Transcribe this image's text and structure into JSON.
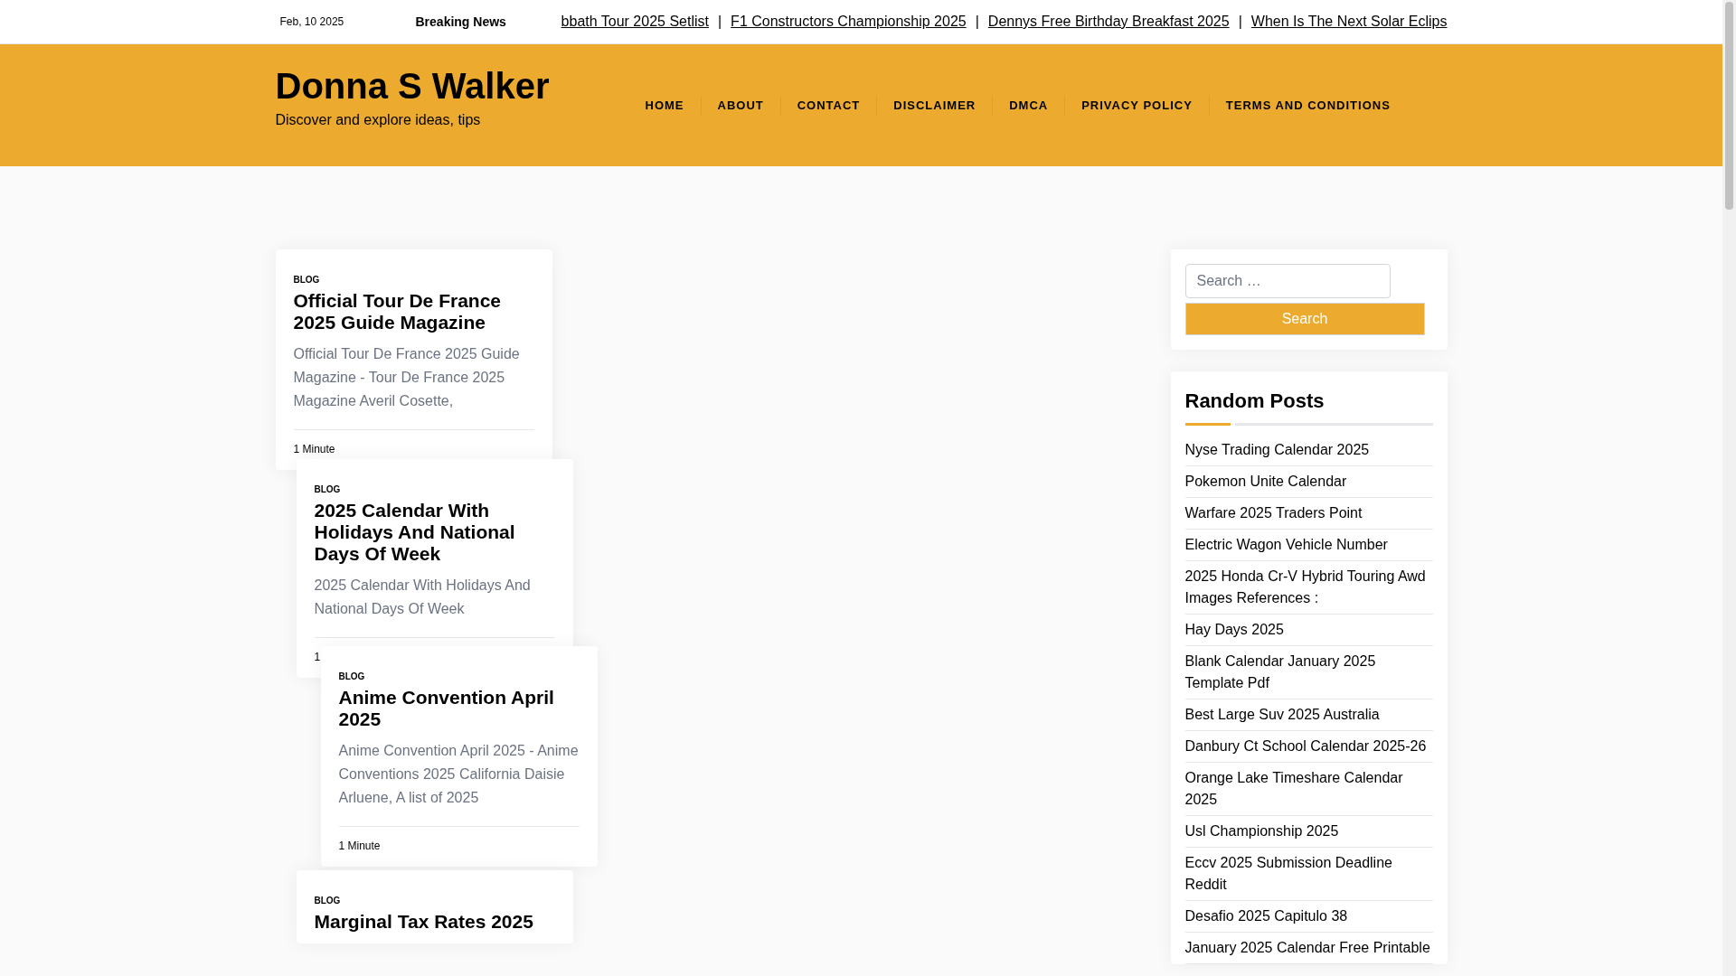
{
  "top_bar": {
    "date": "Feb, 10 2025",
    "breaking_label": "Breaking News",
    "ticker": [
      {
        "text": "bbath Tour 2025 Setlist"
      },
      {
        "separator": "|",
        "text": "F1 Constructors Championship 2025"
      },
      {
        "separator": "|",
        "text": "Dennys Free Birthday Breakfast 2025"
      },
      {
        "separator": "|",
        "text": "When Is The Next Solar Eclips"
      }
    ]
  },
  "header": {
    "site_title": "Donna S Walker",
    "tagline": "Discover and explore ideas, tips",
    "nav": [
      "HOME",
      "ABOUT",
      "CONTACT",
      "DISCLAIMER",
      "DMCA",
      "PRIVACY POLICY",
      "TERMS AND CONDITIONS"
    ]
  },
  "posts": [
    {
      "category": "BLOG",
      "title": "Official Tour De France 2025 Guide Magazine",
      "excerpt": "Official Tour De France 2025 Guide Magazine - Tour De France 2025 Magazine Averil Cosette,",
      "read_time": "1 Minute"
    },
    {
      "category": "BLOG",
      "title": "2025 Calendar With Holidays And National Days Of Week",
      "excerpt": "2025 Calendar With Holidays And National Days Of Week",
      "read_time": "1"
    },
    {
      "category": "BLOG",
      "title": "Anime Convention April 2025",
      "excerpt": "Anime Convention April 2025 - Anime Conventions 2025 California Daisie Arluene, A list of 2025",
      "read_time": "1 Minute"
    },
    {
      "category": "BLOG",
      "title": "Marginal Tax Rates 2025"
    }
  ],
  "sidebar": {
    "search": {
      "placeholder": "Search …",
      "button": "Search"
    },
    "random_posts": {
      "title": "Random Posts",
      "items": [
        "Nyse Trading Calendar 2025",
        "Pokemon Unite Calendar",
        "Warfare 2025 Traders Point",
        "Electric Wagon Vehicle Number",
        "2025 Honda Cr-V Hybrid Touring Awd Images References :",
        "Hay Days 2025",
        "Blank Calendar January 2025 Template Pdf",
        "Best Large Suv 2025 Australia",
        "Danbury Ct School Calendar 2025-26",
        "Orange Lake Timeshare Calendar 2025",
        "Usl Championship 2025",
        "Eccv 2025 Submission Deadline Reddit",
        "Desafio 2025 Capitulo 38",
        "January 2025 Calendar Free Printable"
      ]
    }
  }
}
